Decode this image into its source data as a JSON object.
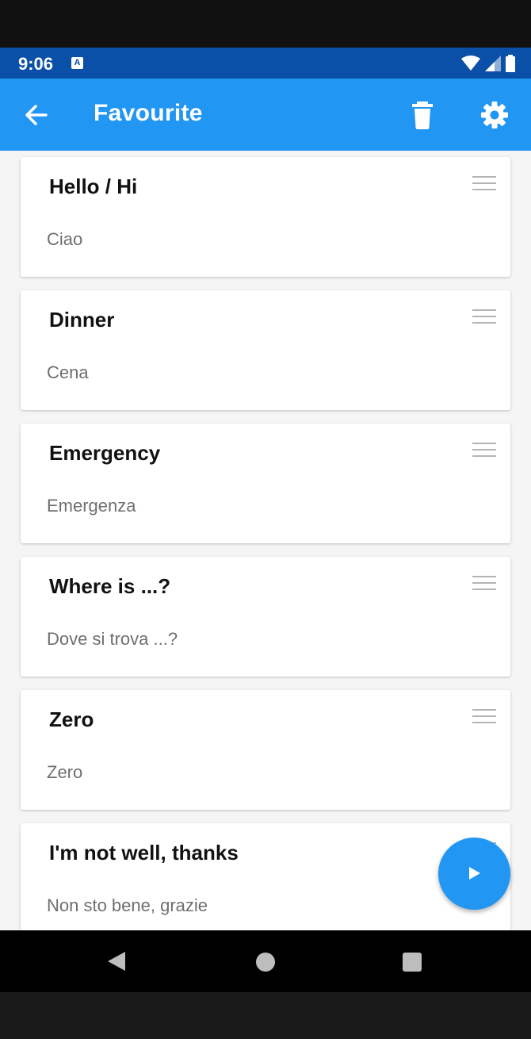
{
  "status_bar": {
    "time": "9:06",
    "notification_badge": "A"
  },
  "app_bar": {
    "title": "Favourite",
    "back_icon": "arrow-left-icon",
    "delete_icon": "trash-icon",
    "settings_icon": "gear-icon",
    "color": "#2196f3"
  },
  "favourites": [
    {
      "phrase": "Hello / Hi",
      "translation": "Ciao"
    },
    {
      "phrase": "Dinner",
      "translation": "Cena"
    },
    {
      "phrase": "Emergency",
      "translation": "Emergenza"
    },
    {
      "phrase": "Where is ...?",
      "translation": "Dove si trova ...?"
    },
    {
      "phrase": "Zero",
      "translation": "Zero"
    },
    {
      "phrase": "I'm not well, thanks",
      "translation": "Non sto bene, grazie"
    }
  ],
  "fab": {
    "icon": "play-icon"
  },
  "nav": {
    "back_icon": "nav-back-icon",
    "home_icon": "nav-home-icon",
    "recent_icon": "nav-recents-icon"
  }
}
